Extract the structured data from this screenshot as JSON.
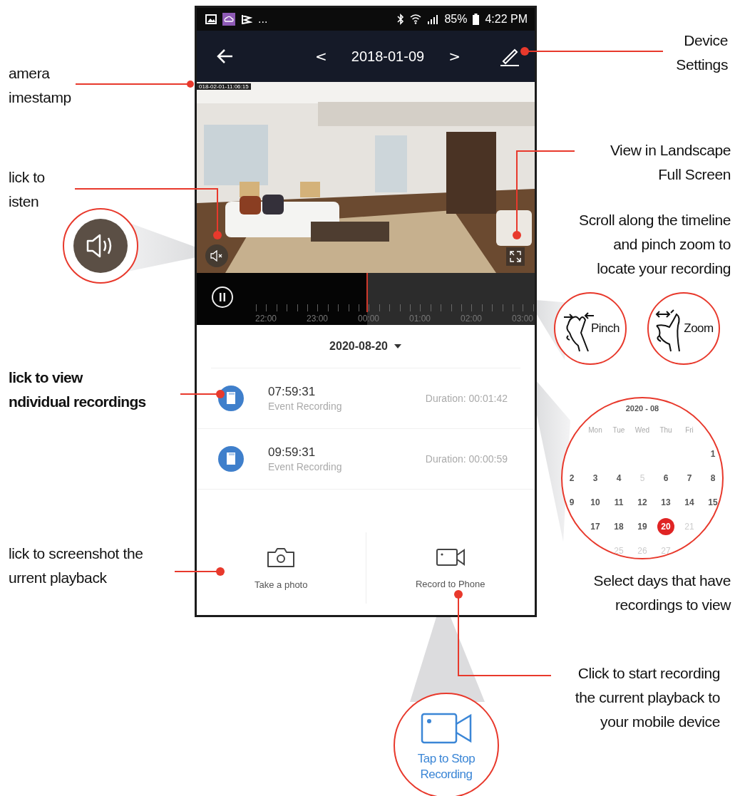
{
  "status_bar": {
    "overflow": "...",
    "battery": "85%",
    "time": "4:22 PM"
  },
  "nav": {
    "prev": "<",
    "date": "2018-01-09",
    "next": ">"
  },
  "video": {
    "timestamp": "018-02-01-11:06:15"
  },
  "timeline": {
    "labels": [
      "22:00",
      "23:00",
      "00:00",
      "01:00",
      "02:00",
      "03:00"
    ]
  },
  "recordings": {
    "date": "2020-08-20",
    "items": [
      {
        "time": "07:59:31",
        "type": "Event Recording",
        "duration": "Duration: 00:01:42"
      },
      {
        "time": "09:59:31",
        "type": "Event Recording",
        "duration": "Duration: 00:00:59"
      }
    ]
  },
  "actions": [
    {
      "label": "Take a photo"
    },
    {
      "kind": "record",
      "label": "Record to Phone"
    }
  ],
  "callouts": [
    {
      "text": "amera\nimestamp",
      "emphasis": false
    },
    {
      "text": "Device\nSettings",
      "emphasis": false
    },
    {
      "text": "lick to\nisten",
      "emphasis": false
    },
    {
      "text": "View in Landscape\nFull Screen",
      "emphasis": false
    },
    {
      "text": "Scroll along the timeline\nand pinch zoom to\nlocate your recording",
      "emphasis": false
    },
    {
      "text": "lick to view\nndividual recordings",
      "emphasis": true
    },
    {
      "text": "lick to screenshot the\nurrent playback",
      "emphasis": false
    },
    {
      "text": "Select days that have\nrecordings to view",
      "emphasis": false
    },
    {
      "text": "Click to start recording\nthe current playback to\nyour mobile device",
      "emphasis": false
    }
  ],
  "gestures": [
    {
      "kind": "pinch",
      "label": "Pinch"
    },
    {
      "kind": "zoom",
      "label": "Zoom"
    }
  ],
  "calendar": {
    "title": "2020 - 08",
    "weekdays": [
      "Mon",
      "Tue",
      "Wed",
      "Thu",
      "Fri"
    ],
    "weeks": [
      {
        "kind": "from_sat",
        "days": [
          {
            "day": "1",
            "muted": false,
            "selected": false
          }
        ]
      },
      {
        "kind": "from_sun",
        "days": [
          {
            "day": "2",
            "muted": false,
            "selected": false
          },
          {
            "day": "3",
            "muted": false,
            "selected": false
          },
          {
            "day": "4",
            "muted": false,
            "selected": false
          },
          {
            "day": "5",
            "muted": true,
            "selected": false
          },
          {
            "day": "6",
            "muted": false,
            "selected": false
          },
          {
            "day": "7",
            "muted": false,
            "selected": false
          },
          {
            "day": "8",
            "muted": false,
            "selected": false
          }
        ]
      },
      {
        "kind": "from_sun",
        "days": [
          {
            "day": "9",
            "muted": false,
            "selected": false
          },
          {
            "day": "10",
            "muted": false,
            "selected": false
          },
          {
            "day": "11",
            "muted": false,
            "selected": false
          },
          {
            "day": "12",
            "muted": false,
            "selected": false
          },
          {
            "day": "13",
            "muted": false,
            "selected": false
          },
          {
            "day": "14",
            "muted": false,
            "selected": false
          },
          {
            "day": "15",
            "muted": false,
            "selected": false
          }
        ]
      },
      {
        "kind": "from_mon",
        "days": [
          {
            "day": "17",
            "muted": false,
            "selected": false
          },
          {
            "day": "18",
            "muted": false,
            "selected": false
          },
          {
            "day": "19",
            "muted": false,
            "selected": false
          },
          {
            "day": "20",
            "muted": false,
            "selected": true
          },
          {
            "day": "21",
            "muted": true,
            "selected": false
          }
        ]
      },
      {
        "kind": "from_tue",
        "days": [
          {
            "day": "25",
            "muted": true,
            "selected": false
          },
          {
            "day": "26",
            "muted": true,
            "selected": false
          },
          {
            "day": "27",
            "muted": true,
            "selected": false
          }
        ]
      }
    ]
  },
  "stop_badge": {
    "label": "Tap to Stop Recording"
  }
}
